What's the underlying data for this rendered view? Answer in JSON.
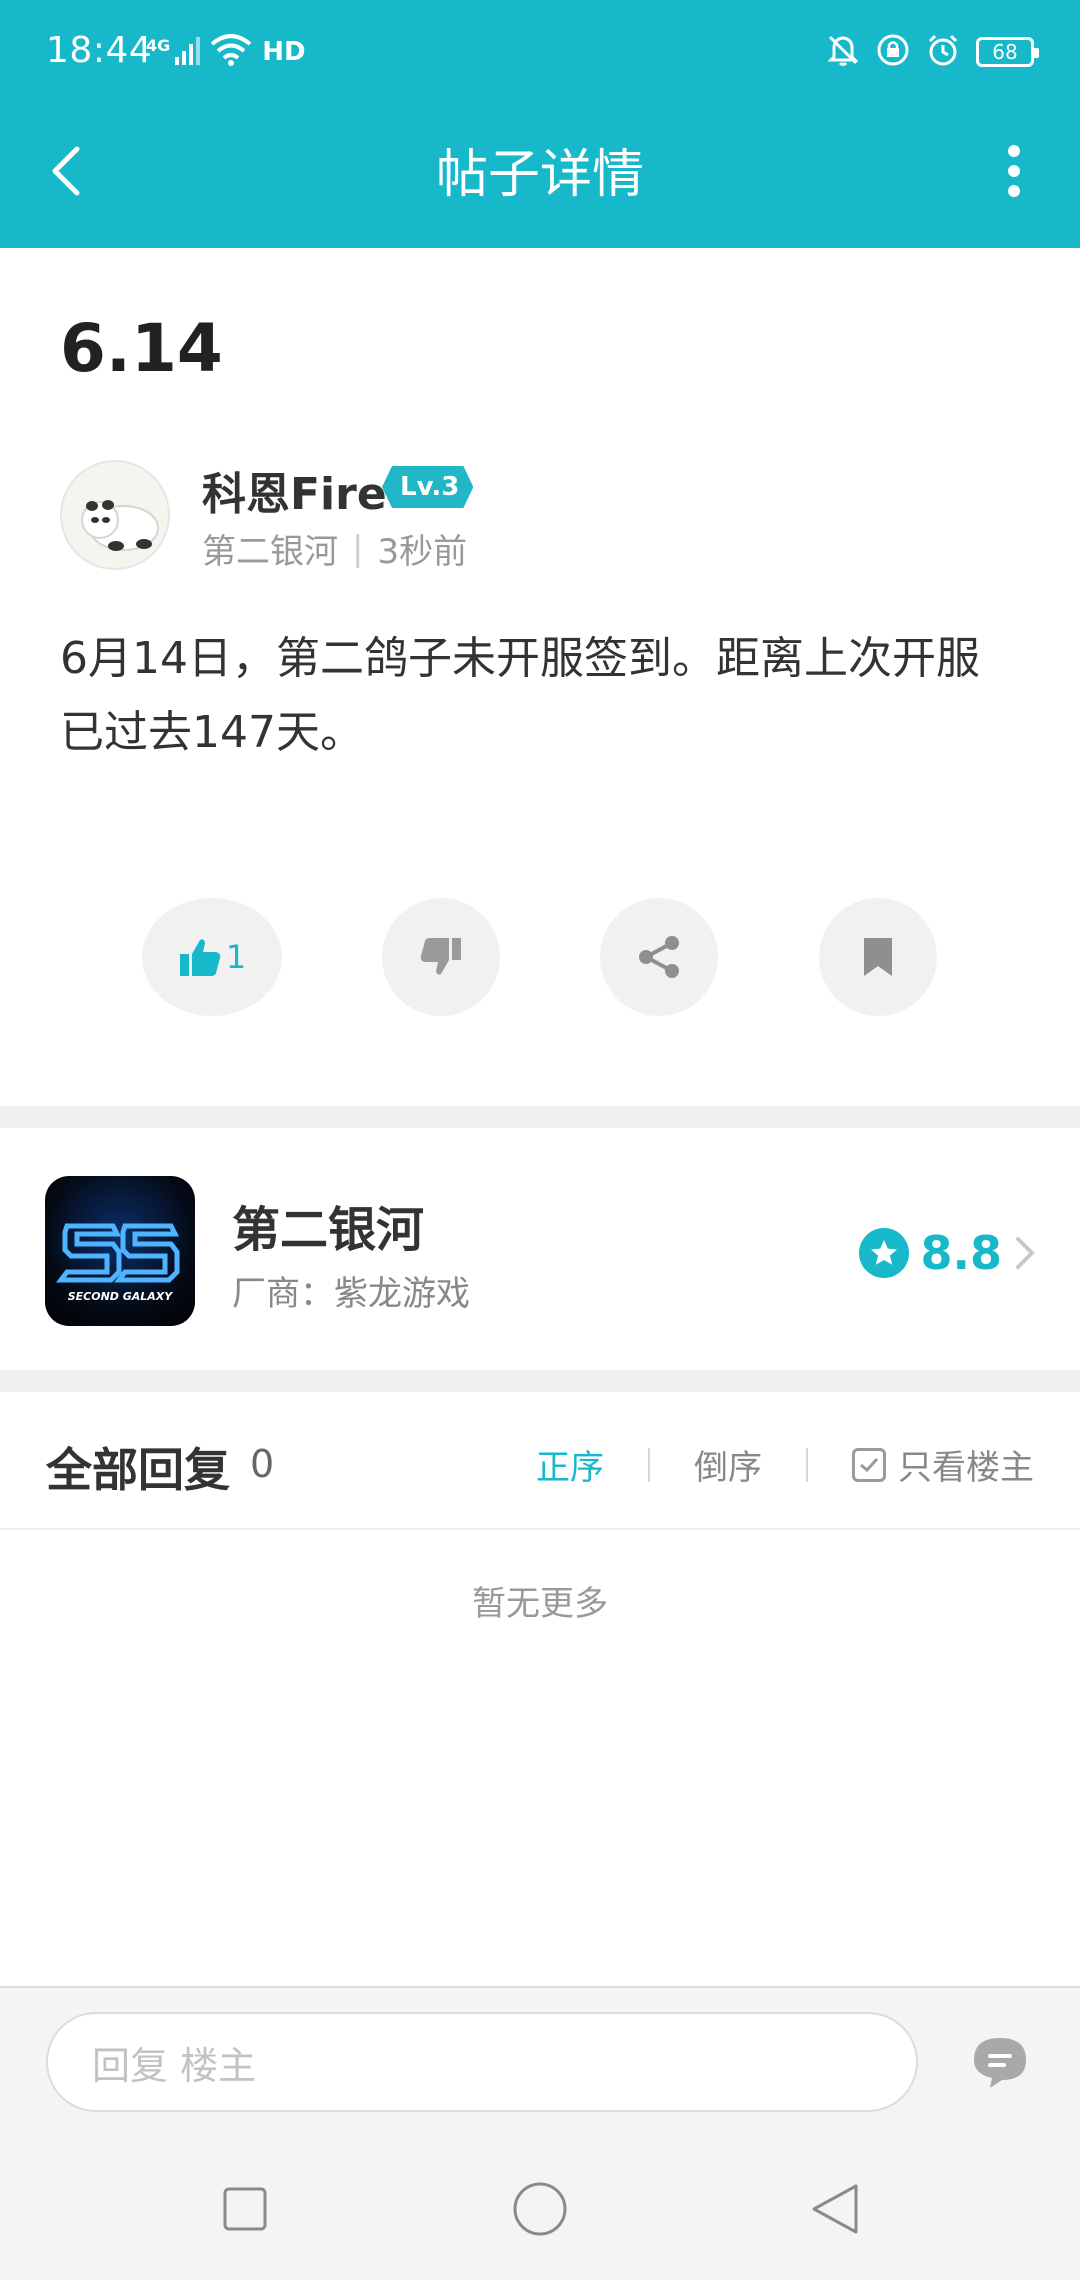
{
  "status_bar": {
    "time": "18:44",
    "network": "4G",
    "hd": "HD",
    "battery": "68"
  },
  "nav": {
    "title": "帖子详情",
    "back_icon": "chevron-left-icon",
    "more_icon": "more-vertical-icon"
  },
  "post": {
    "title": "6.14",
    "author": {
      "name": "科恩Fire",
      "level": "Lv.3",
      "forum": "第二银河",
      "separator": "|",
      "time": "3秒前"
    },
    "content": "6月14日，第二鸽子未开服签到。距离上次开服已过去147天。",
    "actions": {
      "like_count": "1"
    }
  },
  "game": {
    "name": "第二银河",
    "vendor": "厂商：紫龙游戏",
    "rating": "8.8"
  },
  "replies": {
    "title": "全部回复",
    "count": "0",
    "sort_asc": "正序",
    "sort_desc": "倒序",
    "only_owner": "只看楼主",
    "empty": "暂无更多"
  },
  "reply_bar": {
    "placeholder": "回复  楼主"
  },
  "colors": {
    "accent": "#16b8c9",
    "divider": "#efefef"
  }
}
